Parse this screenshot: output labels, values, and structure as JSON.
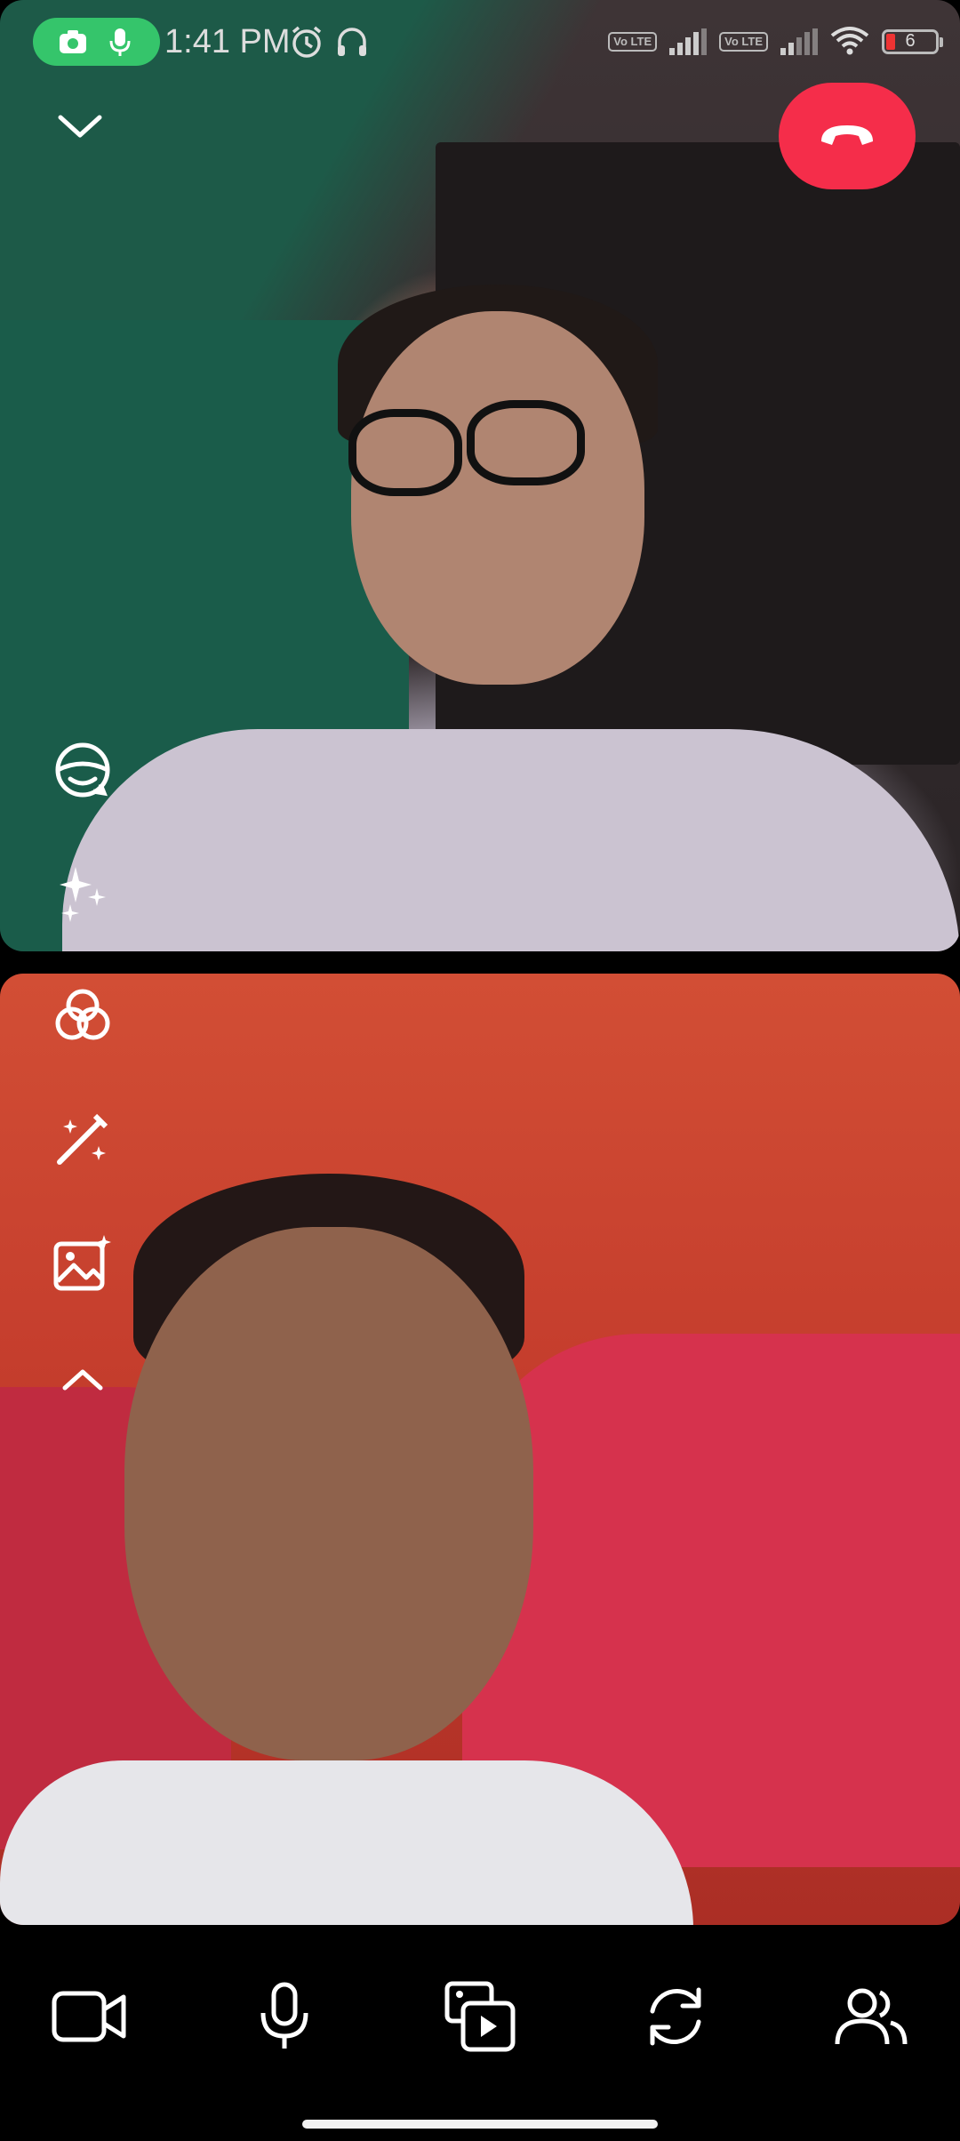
{
  "status_bar": {
    "time": "1:41 PM",
    "recording_indicators": [
      "camera-icon",
      "mic-icon"
    ],
    "network_badges": [
      "Vo LTE",
      "Vo LTE"
    ],
    "battery_level": "6",
    "icons": [
      "alarm-icon",
      "headset-icon",
      "signal-icon",
      "wifi-icon",
      "battery-icon"
    ]
  },
  "call": {
    "collapse_icon": "chevron-down-icon",
    "end_call_icon": "end-call-icon",
    "end_call_color": "#f52d4a",
    "accent_green": "#35c56b"
  },
  "effects_toolbar": {
    "items": [
      {
        "name": "avatar-effect",
        "icon": "avatar-face-icon"
      },
      {
        "name": "sparkle-effects",
        "icon": "sparkles-icon"
      },
      {
        "name": "color-filters",
        "icon": "color-filter-icon"
      },
      {
        "name": "touch-up",
        "icon": "magic-wand-icon"
      },
      {
        "name": "background",
        "icon": "image-sparkle-icon"
      },
      {
        "name": "collapse-effects",
        "icon": "chevron-up-icon"
      }
    ]
  },
  "bottom_bar": {
    "buttons": [
      {
        "name": "video-toggle",
        "icon": "video-camera-icon"
      },
      {
        "name": "mic-toggle",
        "icon": "microphone-icon"
      },
      {
        "name": "share-media",
        "icon": "media-share-icon"
      },
      {
        "name": "flip-camera",
        "icon": "flip-camera-icon"
      },
      {
        "name": "participants",
        "icon": "people-icon"
      }
    ]
  }
}
